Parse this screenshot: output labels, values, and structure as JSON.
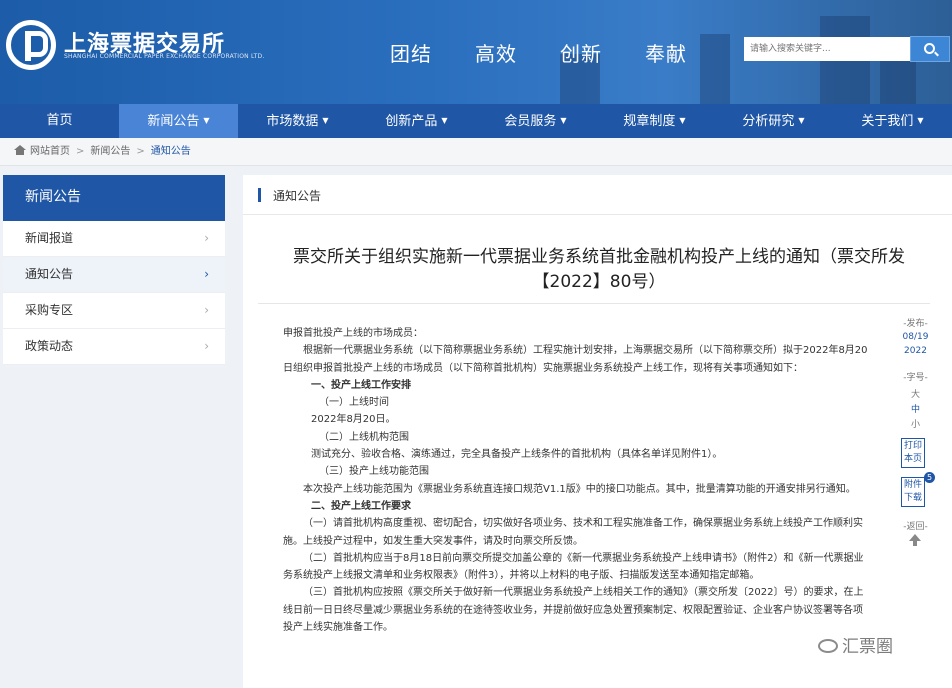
{
  "header": {
    "logo_cn": "上海票据交易所",
    "logo_en": "SHANGHAI COMMERCIAL PAPER EXCHANGE CORPORATION LTD.",
    "slogans": [
      "团结",
      "高效",
      "创新",
      "奉献"
    ],
    "search_placeholder": "请输入搜索关键字..."
  },
  "nav": [
    {
      "label": "首页",
      "caret": ""
    },
    {
      "label": "新闻公告",
      "caret": "▼"
    },
    {
      "label": "市场数据",
      "caret": "▼"
    },
    {
      "label": "创新产品",
      "caret": "▼"
    },
    {
      "label": "会员服务",
      "caret": "▼"
    },
    {
      "label": "规章制度",
      "caret": "▼"
    },
    {
      "label": "分析研究",
      "caret": "▼"
    },
    {
      "label": "关于我们",
      "caret": "▼"
    }
  ],
  "breadcrumb": {
    "home": "网站首页",
    "level1": "新闻公告",
    "current": "通知公告",
    "sep": ">"
  },
  "sidebar": {
    "title": "新闻公告",
    "items": [
      {
        "label": "新闻报道",
        "arrow": "›"
      },
      {
        "label": "通知公告",
        "arrow": "›"
      },
      {
        "label": "采购专区",
        "arrow": "›"
      },
      {
        "label": "政策动态",
        "arrow": "›"
      }
    ]
  },
  "section": {
    "title": "通知公告"
  },
  "article": {
    "title": "票交所关于组织实施新一代票据业务系统首批金融机构投产上线的通知（票交所发【2022】80号）",
    "paragraphs": [
      "申报首批投产上线的市场成员：",
      "根据新一代票据业务系统（以下简称票据业务系统）工程实施计划安排，上海票据交易所（以下简称票交所）拟于2022年8月20日组织申报首批投产上线的市场成员（以下简称首批机构）实施票据业务系统投产上线工作，现将有关事项通知如下：",
      "一、投产上线工作安排",
      "（一）上线时间",
      "2022年8月20日。",
      "（二）上线机构范围",
      "测试充分、验收合格、演练通过，完全具备投产上线条件的首批机构（具体名单详见附件1）。",
      "（三）投产上线功能范围",
      "本次投产上线功能范围为《票据业务系统直连接口规范V1.1版》中的接口功能点。其中，批量清算功能的开通安排另行通知。",
      "二、投产上线工作要求",
      "（一）请首批机构高度重视、密切配合，切实做好各项业务、技术和工程实施准备工作，确保票据业务系统上线投产工作顺利实施。上线投产过程中，如发生重大突发事件，请及时向票交所反馈。",
      "（二）首批机构应当于8月18日前向票交所提交加盖公章的《新一代票据业务系统投产上线申请书》（附件2）和《新一代票据业务系统投产上线报文清单和业务权限表》（附件3），并将以上材料的电子版、扫描版发送至本通知指定邮箱。",
      "（三）首批机构应按照《票交所关于做好新一代票据业务系统投产上线相关工作的通知》（票交所发〔2022〕号）的要求，在上线日前一日日终尽量减少票据业务系统的在途待签收业务，并提前做好应急处置预案制定、权限配置验证、企业客户协议签署等各项投产上线实施准备工作。"
    ]
  },
  "tools": {
    "publish_label": "-发布-",
    "date_md": "08/19",
    "date_year": "2022",
    "font_label": "-字号-",
    "font_large": "大",
    "font_medium": "中",
    "font_small": "小",
    "print_label": "打印本页",
    "attach_label": "附件下载",
    "attach_count": "5",
    "back_label": "-返回-"
  },
  "watermark": "汇票圈"
}
